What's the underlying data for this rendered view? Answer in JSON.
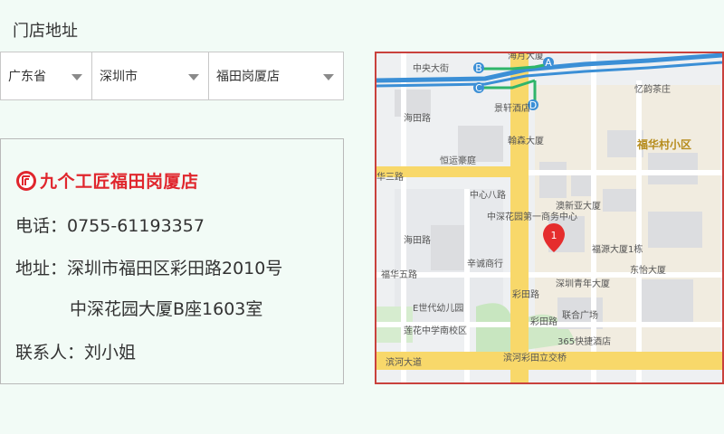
{
  "page": {
    "title": "门店地址"
  },
  "selects": [
    {
      "value": "广东省"
    },
    {
      "value": "深圳市"
    },
    {
      "value": "福田岗厦店"
    }
  ],
  "store": {
    "brand_name": "九个工匠福田岗厦店",
    "phone": "电话：0755-61193357",
    "address_line1": "地址：深圳市福田区彩田路2010号",
    "address_line2": "中深花园大厦B座1603室",
    "contact": "联系人：刘小姐"
  },
  "map": {
    "labels": {
      "zhongyang": "中央大街",
      "haiyue": "海月大厦",
      "yiyun": "忆韵茶庄",
      "jingxuan": "景轩酒店",
      "hanlin": "翰森大厦",
      "futian_village": "福华村小区",
      "hengyun": "恒运豪庭",
      "huasan": "华三路",
      "zhongxin8": "中心八路",
      "zhongshen": "中深花园第一商务中心",
      "aoxinya": "澳新亚大厦",
      "fuyuan": "福源大厦1栋",
      "dongyi": "东怡大厦",
      "haitian": "海田路",
      "xincheng": "辛诚商行",
      "futian5": "福华五路",
      "qingnian": "深圳青年大厦",
      "eshijie": "E世代幼儿园",
      "lianhe": "联合广场",
      "lianhua": "莲花中学南校区",
      "caitian": "彩田路",
      "hotel365": "365快捷酒店",
      "binhe": "滨河大道",
      "binhe_caitian": "滨河彩田立交桥",
      "haitian_left": "海田路",
      "caitian2": "彩田路"
    },
    "markers": [
      "A",
      "B",
      "C",
      "D"
    ],
    "pin": "1",
    "colors": {
      "main_road": "#f8d86a",
      "highway": "#3b8fd6",
      "route": "#2fb56a",
      "pin": "#e52d2d"
    }
  }
}
